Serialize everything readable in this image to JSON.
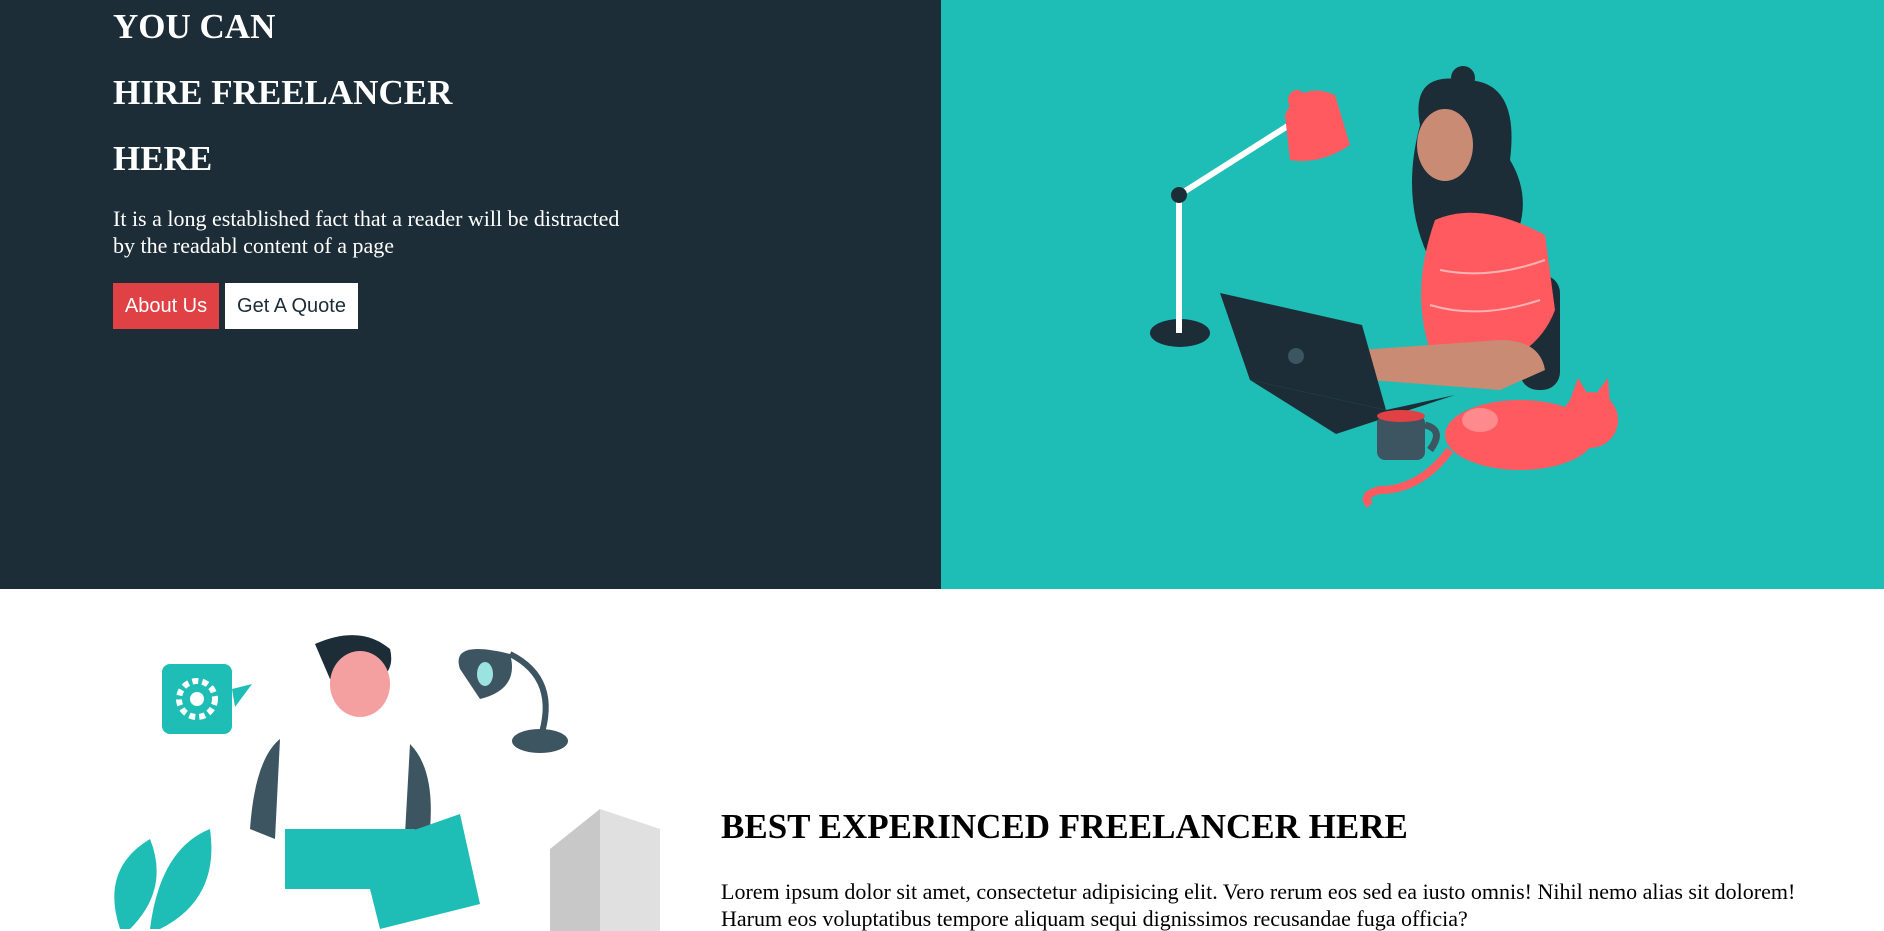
{
  "hero": {
    "title_line1": "YOU CAN",
    "title_line2": "HIRE FREELANCER",
    "title_line3": "HERE",
    "description": "It is a long established fact that a reader will be distracted by the readabl content of a page",
    "about_button": "About Us",
    "quote_button": "Get A Quote"
  },
  "about": {
    "title": "BEST EXPERINCED FREELANCER HERE",
    "text": "Lorem ipsum dolor sit amet, consectetur adipisicing elit. Vero rerum eos sed ea iusto omnis! Nihil nemo alias sit dolorem! Harum eos voluptatibus tempore aliquam sequi dignissimos recusandae fuga officia?"
  },
  "colors": {
    "hero_dark": "#1c2d37",
    "hero_teal": "#1ebdb6",
    "accent_red": "#e04145",
    "coral": "#ff5a5f"
  }
}
